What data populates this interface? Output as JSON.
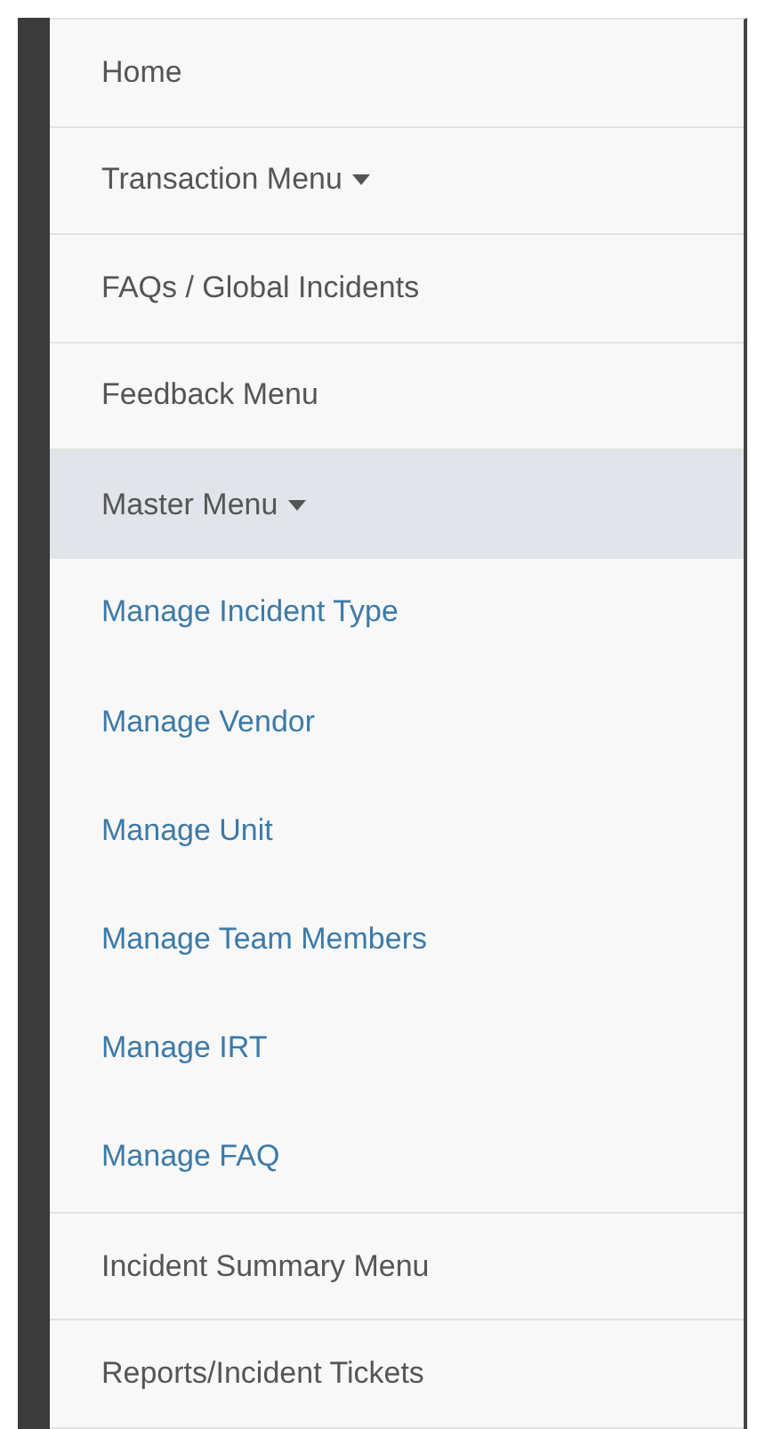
{
  "sidebar": {
    "items": [
      {
        "label": "Home",
        "kind": "link"
      },
      {
        "label": "Transaction Menu",
        "kind": "dropdown",
        "expanded": false
      },
      {
        "label": "FAQs / Global Incidents",
        "kind": "link"
      },
      {
        "label": "Feedback Menu",
        "kind": "link"
      },
      {
        "label": "Master Menu",
        "kind": "dropdown",
        "expanded": true,
        "children": [
          {
            "label": "Manage Incident Type"
          },
          {
            "label": "Manage Vendor"
          },
          {
            "label": "Manage Unit"
          },
          {
            "label": "Manage Team Members"
          },
          {
            "label": "Manage IRT"
          },
          {
            "label": "Manage FAQ"
          }
        ]
      },
      {
        "label": "Incident Summary Menu",
        "kind": "link"
      },
      {
        "label": "Reports/Incident Tickets",
        "kind": "link"
      }
    ]
  }
}
